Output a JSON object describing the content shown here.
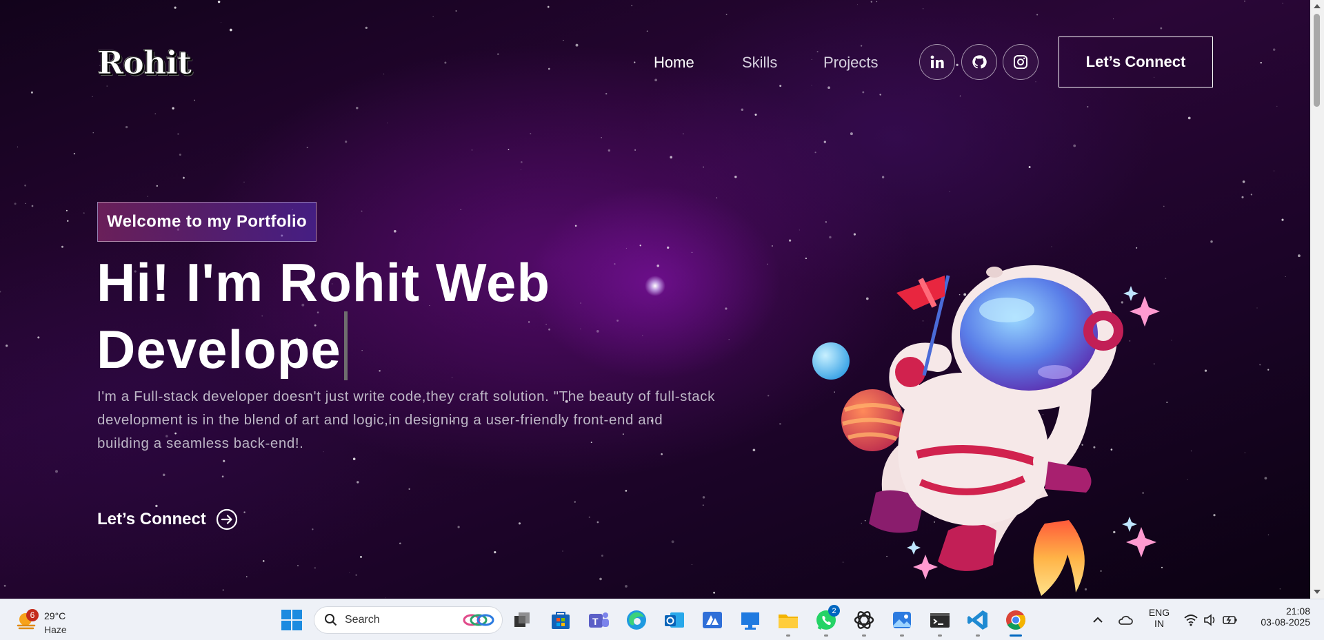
{
  "nav": {
    "logo": "Rohit",
    "links": [
      "Home",
      "Skills",
      "Projects"
    ],
    "social": [
      "linkedin-icon",
      "github-icon",
      "instagram-icon"
    ],
    "cta": "Let’s Connect"
  },
  "hero": {
    "tagline": "Welcome to my Portfolio",
    "headline_line1": "Hi! I'm Rohit Web",
    "headline_line2": "Develope",
    "description": "I'm a Full-stack developer doesn't just write code,they craft solution. \"The beauty of full-stack development is in the blend of art and logic,in designing a user-friendly front-end and building a seamless back-end!.",
    "connect": "Let’s Connect"
  },
  "taskbar": {
    "weather": {
      "badge": "6",
      "temp": "29°C",
      "condition": "Haze"
    },
    "search_placeholder": "Search",
    "apps": [
      "windows-start-icon",
      "task-view-icon",
      "microsoft-store-icon",
      "teams-icon",
      "edge-icon",
      "outlook-icon",
      "azure-icon",
      "todo-icon",
      "file-explorer-icon",
      "whatsapp-icon",
      "chatgpt-icon",
      "photos-icon",
      "terminal-icon",
      "vscode-icon",
      "chrome-icon"
    ],
    "whatsapp_badge": "2",
    "language_line1": "ENG",
    "language_line2": "IN",
    "time": "21:08",
    "date": "03-08-2025"
  },
  "colors": {
    "accent_gradient_start": "#aa367c",
    "accent_gradient_end": "#4a2fbd",
    "taskbar_active": "#0067c0"
  }
}
